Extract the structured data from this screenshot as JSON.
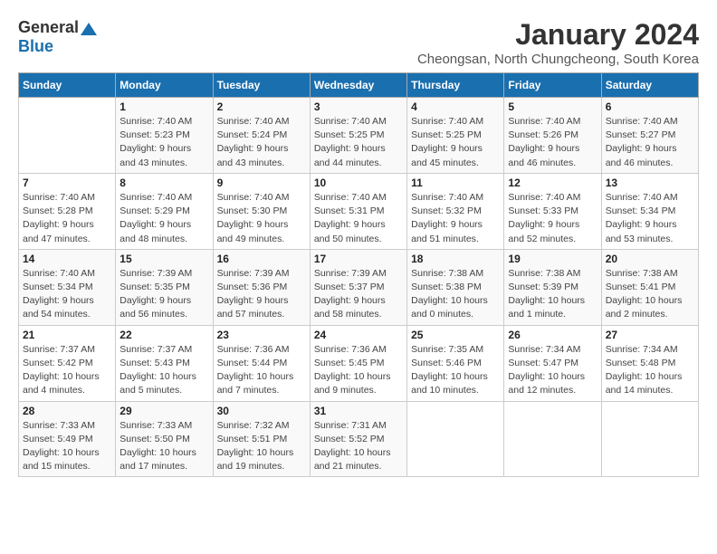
{
  "logo": {
    "general": "General",
    "blue": "Blue"
  },
  "header": {
    "title": "January 2024",
    "subtitle": "Cheongsan, North Chungcheong, South Korea"
  },
  "weekdays": [
    "Sunday",
    "Monday",
    "Tuesday",
    "Wednesday",
    "Thursday",
    "Friday",
    "Saturday"
  ],
  "weeks": [
    [
      {
        "day": "",
        "sunrise": "",
        "sunset": "",
        "daylight": ""
      },
      {
        "day": "1",
        "sunrise": "Sunrise: 7:40 AM",
        "sunset": "Sunset: 5:23 PM",
        "daylight": "Daylight: 9 hours and 43 minutes."
      },
      {
        "day": "2",
        "sunrise": "Sunrise: 7:40 AM",
        "sunset": "Sunset: 5:24 PM",
        "daylight": "Daylight: 9 hours and 43 minutes."
      },
      {
        "day": "3",
        "sunrise": "Sunrise: 7:40 AM",
        "sunset": "Sunset: 5:25 PM",
        "daylight": "Daylight: 9 hours and 44 minutes."
      },
      {
        "day": "4",
        "sunrise": "Sunrise: 7:40 AM",
        "sunset": "Sunset: 5:25 PM",
        "daylight": "Daylight: 9 hours and 45 minutes."
      },
      {
        "day": "5",
        "sunrise": "Sunrise: 7:40 AM",
        "sunset": "Sunset: 5:26 PM",
        "daylight": "Daylight: 9 hours and 46 minutes."
      },
      {
        "day": "6",
        "sunrise": "Sunrise: 7:40 AM",
        "sunset": "Sunset: 5:27 PM",
        "daylight": "Daylight: 9 hours and 46 minutes."
      }
    ],
    [
      {
        "day": "7",
        "sunrise": "Sunrise: 7:40 AM",
        "sunset": "Sunset: 5:28 PM",
        "daylight": "Daylight: 9 hours and 47 minutes."
      },
      {
        "day": "8",
        "sunrise": "Sunrise: 7:40 AM",
        "sunset": "Sunset: 5:29 PM",
        "daylight": "Daylight: 9 hours and 48 minutes."
      },
      {
        "day": "9",
        "sunrise": "Sunrise: 7:40 AM",
        "sunset": "Sunset: 5:30 PM",
        "daylight": "Daylight: 9 hours and 49 minutes."
      },
      {
        "day": "10",
        "sunrise": "Sunrise: 7:40 AM",
        "sunset": "Sunset: 5:31 PM",
        "daylight": "Daylight: 9 hours and 50 minutes."
      },
      {
        "day": "11",
        "sunrise": "Sunrise: 7:40 AM",
        "sunset": "Sunset: 5:32 PM",
        "daylight": "Daylight: 9 hours and 51 minutes."
      },
      {
        "day": "12",
        "sunrise": "Sunrise: 7:40 AM",
        "sunset": "Sunset: 5:33 PM",
        "daylight": "Daylight: 9 hours and 52 minutes."
      },
      {
        "day": "13",
        "sunrise": "Sunrise: 7:40 AM",
        "sunset": "Sunset: 5:34 PM",
        "daylight": "Daylight: 9 hours and 53 minutes."
      }
    ],
    [
      {
        "day": "14",
        "sunrise": "Sunrise: 7:40 AM",
        "sunset": "Sunset: 5:34 PM",
        "daylight": "Daylight: 9 hours and 54 minutes."
      },
      {
        "day": "15",
        "sunrise": "Sunrise: 7:39 AM",
        "sunset": "Sunset: 5:35 PM",
        "daylight": "Daylight: 9 hours and 56 minutes."
      },
      {
        "day": "16",
        "sunrise": "Sunrise: 7:39 AM",
        "sunset": "Sunset: 5:36 PM",
        "daylight": "Daylight: 9 hours and 57 minutes."
      },
      {
        "day": "17",
        "sunrise": "Sunrise: 7:39 AM",
        "sunset": "Sunset: 5:37 PM",
        "daylight": "Daylight: 9 hours and 58 minutes."
      },
      {
        "day": "18",
        "sunrise": "Sunrise: 7:38 AM",
        "sunset": "Sunset: 5:38 PM",
        "daylight": "Daylight: 10 hours and 0 minutes."
      },
      {
        "day": "19",
        "sunrise": "Sunrise: 7:38 AM",
        "sunset": "Sunset: 5:39 PM",
        "daylight": "Daylight: 10 hours and 1 minute."
      },
      {
        "day": "20",
        "sunrise": "Sunrise: 7:38 AM",
        "sunset": "Sunset: 5:41 PM",
        "daylight": "Daylight: 10 hours and 2 minutes."
      }
    ],
    [
      {
        "day": "21",
        "sunrise": "Sunrise: 7:37 AM",
        "sunset": "Sunset: 5:42 PM",
        "daylight": "Daylight: 10 hours and 4 minutes."
      },
      {
        "day": "22",
        "sunrise": "Sunrise: 7:37 AM",
        "sunset": "Sunset: 5:43 PM",
        "daylight": "Daylight: 10 hours and 5 minutes."
      },
      {
        "day": "23",
        "sunrise": "Sunrise: 7:36 AM",
        "sunset": "Sunset: 5:44 PM",
        "daylight": "Daylight: 10 hours and 7 minutes."
      },
      {
        "day": "24",
        "sunrise": "Sunrise: 7:36 AM",
        "sunset": "Sunset: 5:45 PM",
        "daylight": "Daylight: 10 hours and 9 minutes."
      },
      {
        "day": "25",
        "sunrise": "Sunrise: 7:35 AM",
        "sunset": "Sunset: 5:46 PM",
        "daylight": "Daylight: 10 hours and 10 minutes."
      },
      {
        "day": "26",
        "sunrise": "Sunrise: 7:34 AM",
        "sunset": "Sunset: 5:47 PM",
        "daylight": "Daylight: 10 hours and 12 minutes."
      },
      {
        "day": "27",
        "sunrise": "Sunrise: 7:34 AM",
        "sunset": "Sunset: 5:48 PM",
        "daylight": "Daylight: 10 hours and 14 minutes."
      }
    ],
    [
      {
        "day": "28",
        "sunrise": "Sunrise: 7:33 AM",
        "sunset": "Sunset: 5:49 PM",
        "daylight": "Daylight: 10 hours and 15 minutes."
      },
      {
        "day": "29",
        "sunrise": "Sunrise: 7:33 AM",
        "sunset": "Sunset: 5:50 PM",
        "daylight": "Daylight: 10 hours and 17 minutes."
      },
      {
        "day": "30",
        "sunrise": "Sunrise: 7:32 AM",
        "sunset": "Sunset: 5:51 PM",
        "daylight": "Daylight: 10 hours and 19 minutes."
      },
      {
        "day": "31",
        "sunrise": "Sunrise: 7:31 AM",
        "sunset": "Sunset: 5:52 PM",
        "daylight": "Daylight: 10 hours and 21 minutes."
      },
      {
        "day": "",
        "sunrise": "",
        "sunset": "",
        "daylight": ""
      },
      {
        "day": "",
        "sunrise": "",
        "sunset": "",
        "daylight": ""
      },
      {
        "day": "",
        "sunrise": "",
        "sunset": "",
        "daylight": ""
      }
    ]
  ]
}
